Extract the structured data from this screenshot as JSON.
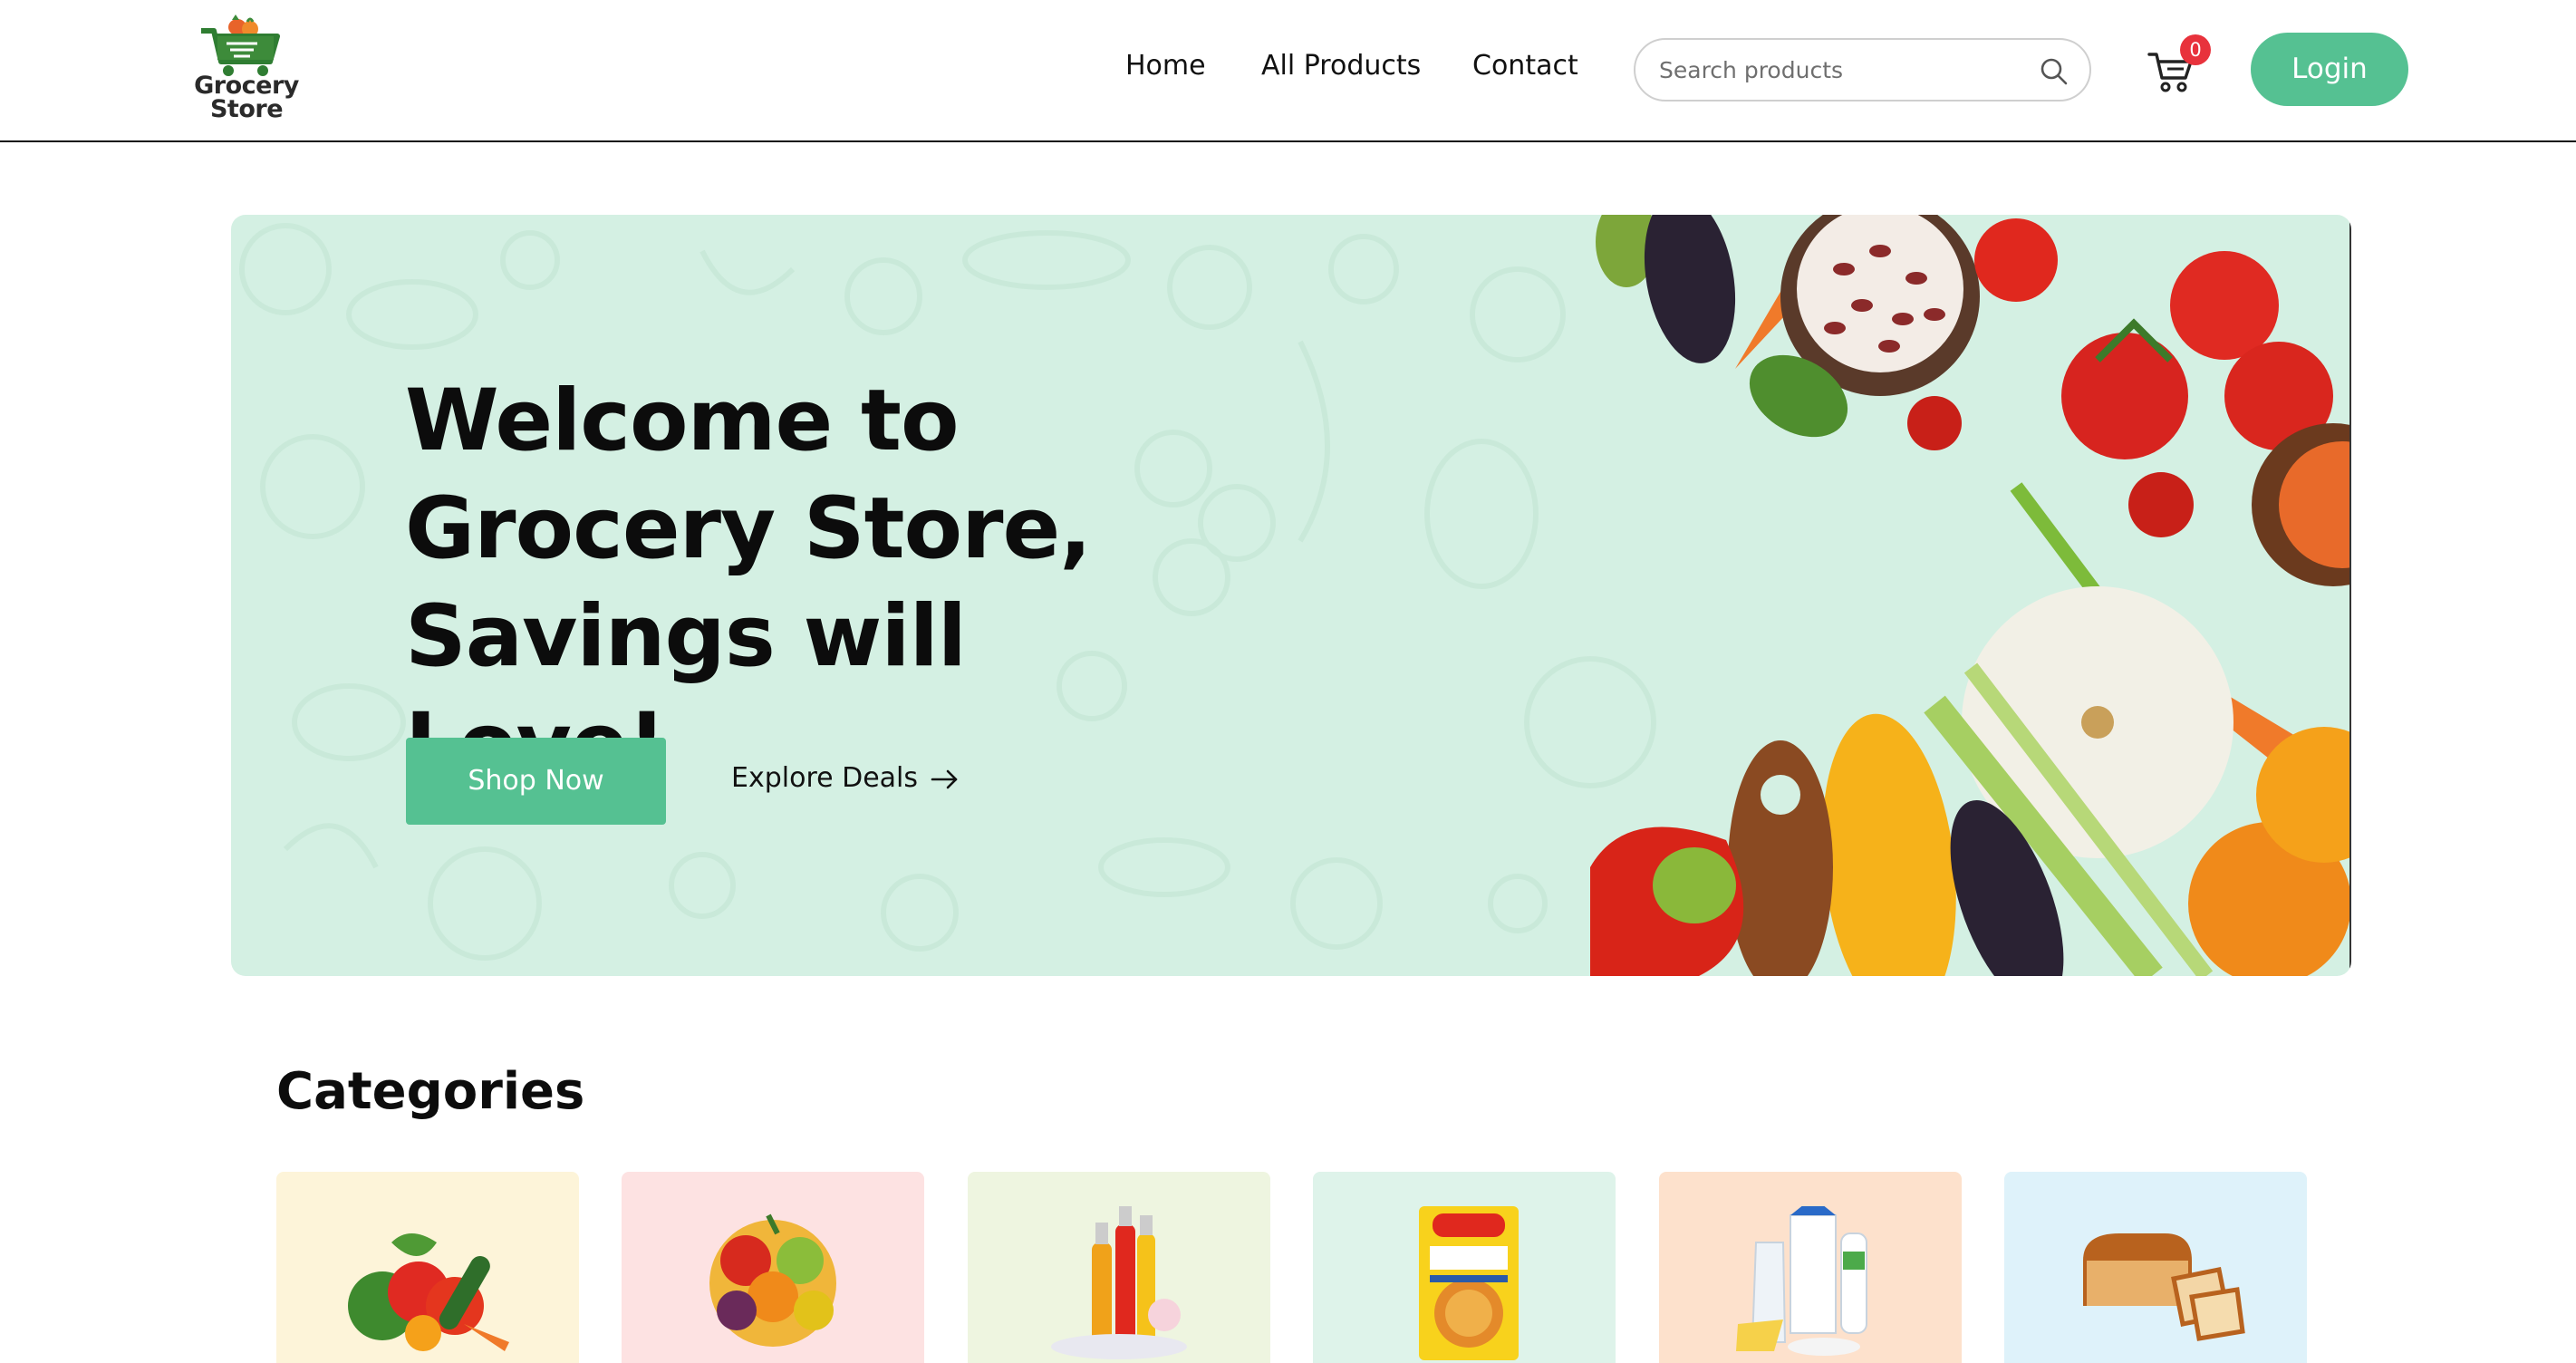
{
  "brand": {
    "line1": "Grocery",
    "line2": "Store",
    "icon": "shopping-cart-logo"
  },
  "nav": {
    "links": [
      {
        "label": "Home"
      },
      {
        "label": "All Products"
      },
      {
        "label": "Contact"
      }
    ],
    "search": {
      "placeholder": "Search products",
      "value": "",
      "icon": "search-icon"
    },
    "cart": {
      "icon": "cart-icon",
      "count": "0"
    },
    "login_label": "Login"
  },
  "hero": {
    "title_line1": "Welcome to",
    "title_line2": "Grocery Store,",
    "title_line3": "Savings will Love!",
    "primary_cta": "Shop Now",
    "secondary_cta": "Explore Deals",
    "secondary_icon": "arrow-right-icon"
  },
  "categories": {
    "title": "Categories",
    "items": [
      {
        "icon": "vegetables-icon",
        "bg": "#fdf4d9"
      },
      {
        "icon": "fruits-icon",
        "bg": "#fde2e2"
      },
      {
        "icon": "beverages-icon",
        "bg": "#eef5e0"
      },
      {
        "icon": "instant-noodles-icon",
        "bg": "#def3ea"
      },
      {
        "icon": "dairy-icon",
        "bg": "#fde1cc"
      },
      {
        "icon": "bakery-icon",
        "bg": "#def2fa"
      }
    ]
  },
  "colors": {
    "accent": "#55c192",
    "hero_bg": "#d4f0e3",
    "badge": "#e8323c"
  }
}
